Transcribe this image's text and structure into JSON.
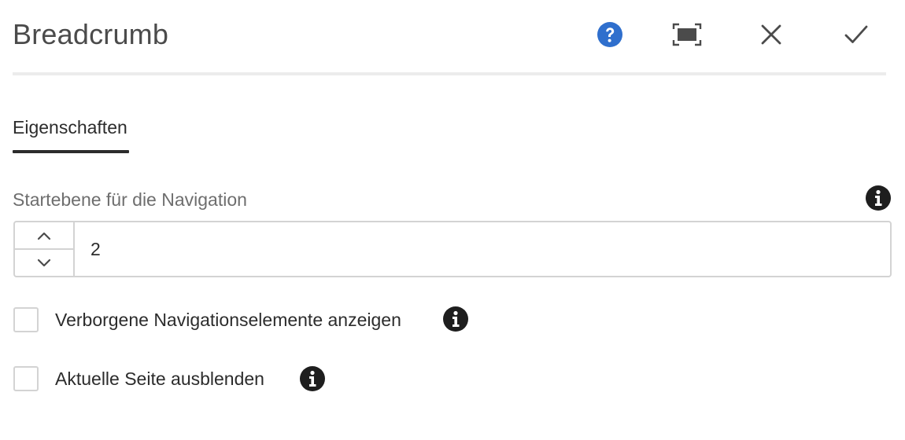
{
  "dialog": {
    "title": "Breadcrumb",
    "actions": {
      "help_icon": "help-icon",
      "fullscreen_icon": "fullscreen-icon",
      "close_icon": "close-icon",
      "done_icon": "checkmark-icon"
    }
  },
  "tabs": [
    {
      "label": "Eigenschaften",
      "selected": true
    }
  ],
  "fields": {
    "start_level": {
      "label": "Startebene für die Navigation",
      "value": "2",
      "info_icon": "info-icon"
    },
    "show_hidden": {
      "label": "Verborgene Navigationselemente anzeigen",
      "checked": false,
      "info_icon": "info-icon"
    },
    "hide_current": {
      "label": "Aktuelle Seite ausblenden",
      "checked": false,
      "info_icon": "info-icon"
    }
  },
  "colors": {
    "help_blue": "#2f6fcd",
    "text": "#2c2c2c",
    "label_gray": "#6e6e6e",
    "border": "#d3d3d3"
  }
}
